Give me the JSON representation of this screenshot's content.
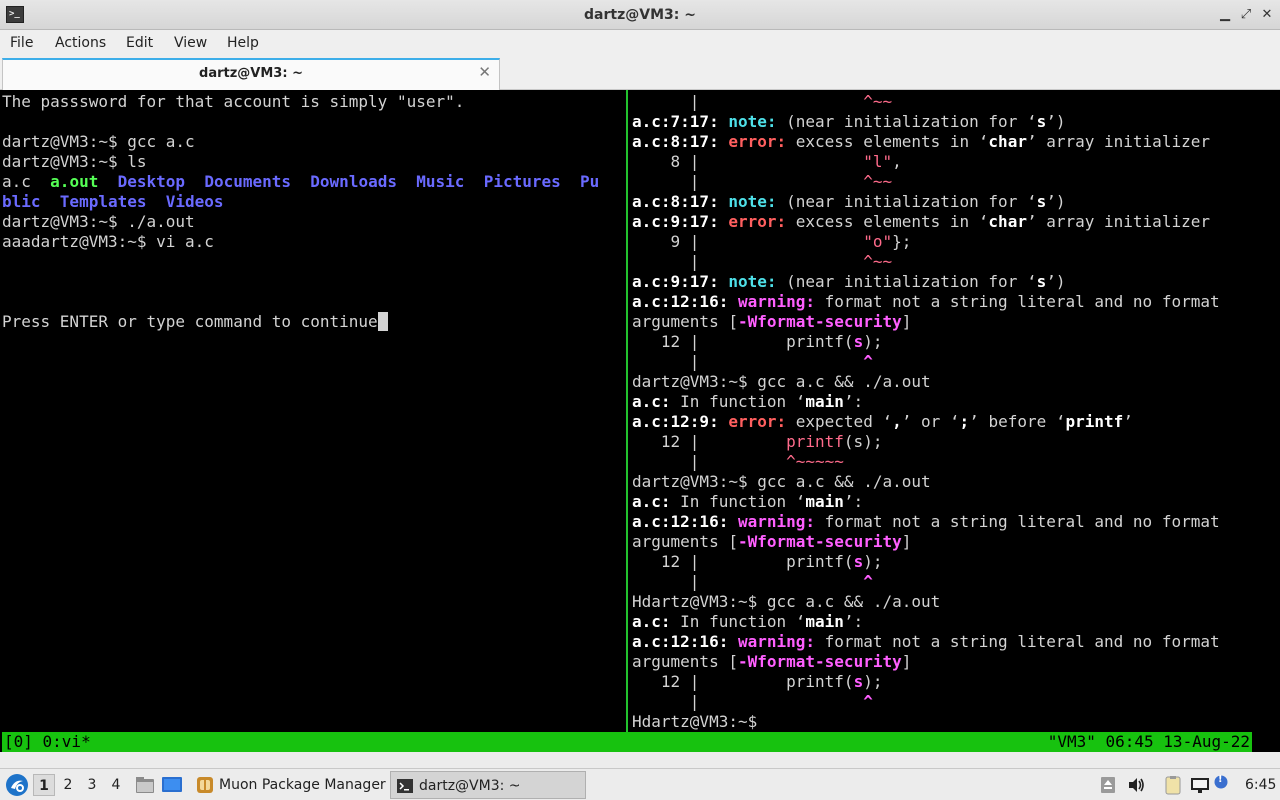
{
  "window": {
    "title": "dartz@VM3: ~",
    "minimize_glyph": "▁",
    "maximize_glyph": "⤢",
    "close_glyph": "✕"
  },
  "menu": [
    "File",
    "Actions",
    "Edit",
    "View",
    "Help"
  ],
  "tab": {
    "label": "dartz@VM3: ~",
    "close_glyph": "✕"
  },
  "left_pane": [
    [
      {
        "t": "The passsword for that account is simply \"user\"."
      }
    ],
    [],
    [
      {
        "t": "dartz@VM3:~$ gcc a.c"
      }
    ],
    [
      {
        "t": "dartz@VM3:~$ ls"
      }
    ],
    [
      {
        "t": "a.c  "
      },
      {
        "t": "a.out",
        "c": "exe"
      },
      {
        "t": "  "
      },
      {
        "t": "Desktop",
        "c": "dirb"
      },
      {
        "t": "  "
      },
      {
        "t": "Documents",
        "c": "dirb"
      },
      {
        "t": "  "
      },
      {
        "t": "Downloads",
        "c": "dirb"
      },
      {
        "t": "  "
      },
      {
        "t": "Music",
        "c": "dirb"
      },
      {
        "t": "  "
      },
      {
        "t": "Pictures",
        "c": "dirb"
      },
      {
        "t": "  "
      },
      {
        "t": "Pu",
        "c": "dirb"
      }
    ],
    [
      {
        "t": "blic",
        "c": "dirb"
      },
      {
        "t": "  "
      },
      {
        "t": "Templates",
        "c": "dirb"
      },
      {
        "t": "  "
      },
      {
        "t": "Videos",
        "c": "dirb"
      }
    ],
    [
      {
        "t": "dartz@VM3:~$ ./a.out"
      }
    ],
    [
      {
        "t": "aaadartz@VM3:~$ vi a.c"
      }
    ],
    [],
    [],
    [],
    [
      {
        "t": "Press ENTER or type command to continue"
      },
      {
        "cursor": true
      }
    ]
  ],
  "right_pane": [
    [
      {
        "t": "      |                 "
      },
      {
        "t": "^~~",
        "c": "caret"
      }
    ],
    [
      {
        "t": "a.c:7:17: ",
        "c": "b"
      },
      {
        "t": "note:",
        "c": "cyan"
      },
      {
        "t": " (near initialization for ‘"
      },
      {
        "t": "s",
        "c": "b"
      },
      {
        "t": "’)"
      }
    ],
    [
      {
        "t": "a.c:8:17: ",
        "c": "b"
      },
      {
        "t": "error:",
        "c": "red"
      },
      {
        "t": " excess elements in ‘"
      },
      {
        "t": "char",
        "c": "b"
      },
      {
        "t": "’ array initializer"
      }
    ],
    [
      {
        "t": "    8 |                 "
      },
      {
        "t": "\"l\"",
        "c": "caret"
      },
      {
        "t": ","
      }
    ],
    [
      {
        "t": "      |                 "
      },
      {
        "t": "^~~",
        "c": "caret"
      }
    ],
    [
      {
        "t": "a.c:8:17: ",
        "c": "b"
      },
      {
        "t": "note:",
        "c": "cyan"
      },
      {
        "t": " (near initialization for ‘"
      },
      {
        "t": "s",
        "c": "b"
      },
      {
        "t": "’)"
      }
    ],
    [
      {
        "t": "a.c:9:17: ",
        "c": "b"
      },
      {
        "t": "error:",
        "c": "red"
      },
      {
        "t": " excess elements in ‘"
      },
      {
        "t": "char",
        "c": "b"
      },
      {
        "t": "’ array initializer"
      }
    ],
    [
      {
        "t": "    9 |                 "
      },
      {
        "t": "\"o\"",
        "c": "caret"
      },
      {
        "t": "};"
      }
    ],
    [
      {
        "t": "      |                 "
      },
      {
        "t": "^~~",
        "c": "caret"
      }
    ],
    [
      {
        "t": "a.c:9:17: ",
        "c": "b"
      },
      {
        "t": "note:",
        "c": "cyan"
      },
      {
        "t": " (near initialization for ‘"
      },
      {
        "t": "s",
        "c": "b"
      },
      {
        "t": "’)"
      }
    ],
    [
      {
        "t": "a.c:12:16: ",
        "c": "b"
      },
      {
        "t": "warning:",
        "c": "mag"
      },
      {
        "t": " format not a string literal and no format"
      }
    ],
    [
      {
        "t": "arguments ["
      },
      {
        "t": "-Wformat-security",
        "c": "mag"
      },
      {
        "t": "]"
      }
    ],
    [
      {
        "t": "   12 |         printf("
      },
      {
        "t": "s",
        "c": "mag"
      },
      {
        "t": ");"
      }
    ],
    [
      {
        "t": "      |                 "
      },
      {
        "t": "^",
        "c": "mag"
      }
    ],
    [
      {
        "t": "dartz@VM3:~$ gcc a.c && ./a.out"
      }
    ],
    [
      {
        "t": "a.c:",
        "c": "b"
      },
      {
        "t": " In function ‘"
      },
      {
        "t": "main",
        "c": "b"
      },
      {
        "t": "’:"
      }
    ],
    [
      {
        "t": "a.c:12:9: ",
        "c": "b"
      },
      {
        "t": "error:",
        "c": "red"
      },
      {
        "t": " expected ‘"
      },
      {
        "t": ",",
        "c": "b"
      },
      {
        "t": "’ or ‘"
      },
      {
        "t": ";",
        "c": "b"
      },
      {
        "t": "’ before ‘"
      },
      {
        "t": "printf",
        "c": "b"
      },
      {
        "t": "’"
      }
    ],
    [
      {
        "t": "   12 |         "
      },
      {
        "t": "printf",
        "c": "caret"
      },
      {
        "t": "(s);"
      }
    ],
    [
      {
        "t": "      |         "
      },
      {
        "t": "^~~~~~",
        "c": "caret"
      }
    ],
    [
      {
        "t": "dartz@VM3:~$ gcc a.c && ./a.out"
      }
    ],
    [
      {
        "t": "a.c:",
        "c": "b"
      },
      {
        "t": " In function ‘"
      },
      {
        "t": "main",
        "c": "b"
      },
      {
        "t": "’:"
      }
    ],
    [
      {
        "t": "a.c:12:16: ",
        "c": "b"
      },
      {
        "t": "warning:",
        "c": "mag"
      },
      {
        "t": " format not a string literal and no format"
      }
    ],
    [
      {
        "t": "arguments ["
      },
      {
        "t": "-Wformat-security",
        "c": "mag"
      },
      {
        "t": "]"
      }
    ],
    [
      {
        "t": "   12 |         printf("
      },
      {
        "t": "s",
        "c": "mag"
      },
      {
        "t": ");"
      }
    ],
    [
      {
        "t": "      |                 "
      },
      {
        "t": "^",
        "c": "mag"
      }
    ],
    [
      {
        "t": "Hdartz@VM3:~$ gcc a.c && ./a.out"
      }
    ],
    [
      {
        "t": "a.c:",
        "c": "b"
      },
      {
        "t": " In function ‘"
      },
      {
        "t": "main",
        "c": "b"
      },
      {
        "t": "’:"
      }
    ],
    [
      {
        "t": "a.c:12:16: ",
        "c": "b"
      },
      {
        "t": "warning:",
        "c": "mag"
      },
      {
        "t": " format not a string literal and no format"
      }
    ],
    [
      {
        "t": "arguments ["
      },
      {
        "t": "-Wformat-security",
        "c": "mag"
      },
      {
        "t": "]"
      }
    ],
    [
      {
        "t": "   12 |         printf("
      },
      {
        "t": "s",
        "c": "mag"
      },
      {
        "t": ");"
      }
    ],
    [
      {
        "t": "      |                 "
      },
      {
        "t": "^",
        "c": "mag"
      }
    ],
    [
      {
        "t": "Hdartz@VM3:~$ "
      }
    ]
  ],
  "tmux": {
    "left": "[0] 0:vi*",
    "right": "\"VM3\" 06:45 13-Aug-22",
    "color": "#17c20f"
  },
  "taskbar": {
    "workspaces": [
      "1",
      "2",
      "3",
      "4"
    ],
    "active_workspace": "1",
    "tasks": [
      {
        "label": "Muon Package Manager",
        "icon": "package-icon"
      },
      {
        "label": "dartz@VM3: ~",
        "icon": "terminal-icon"
      }
    ],
    "clock": "6:45",
    "notification_count": "!"
  },
  "colors": {
    "accent": "#3daee9",
    "pane_divider": "#22c32e",
    "directory": "#6a6aff",
    "executable": "#55ff55",
    "note": "#4ee0e8",
    "error": "#ff5f5f",
    "warning": "#ff5fff"
  }
}
